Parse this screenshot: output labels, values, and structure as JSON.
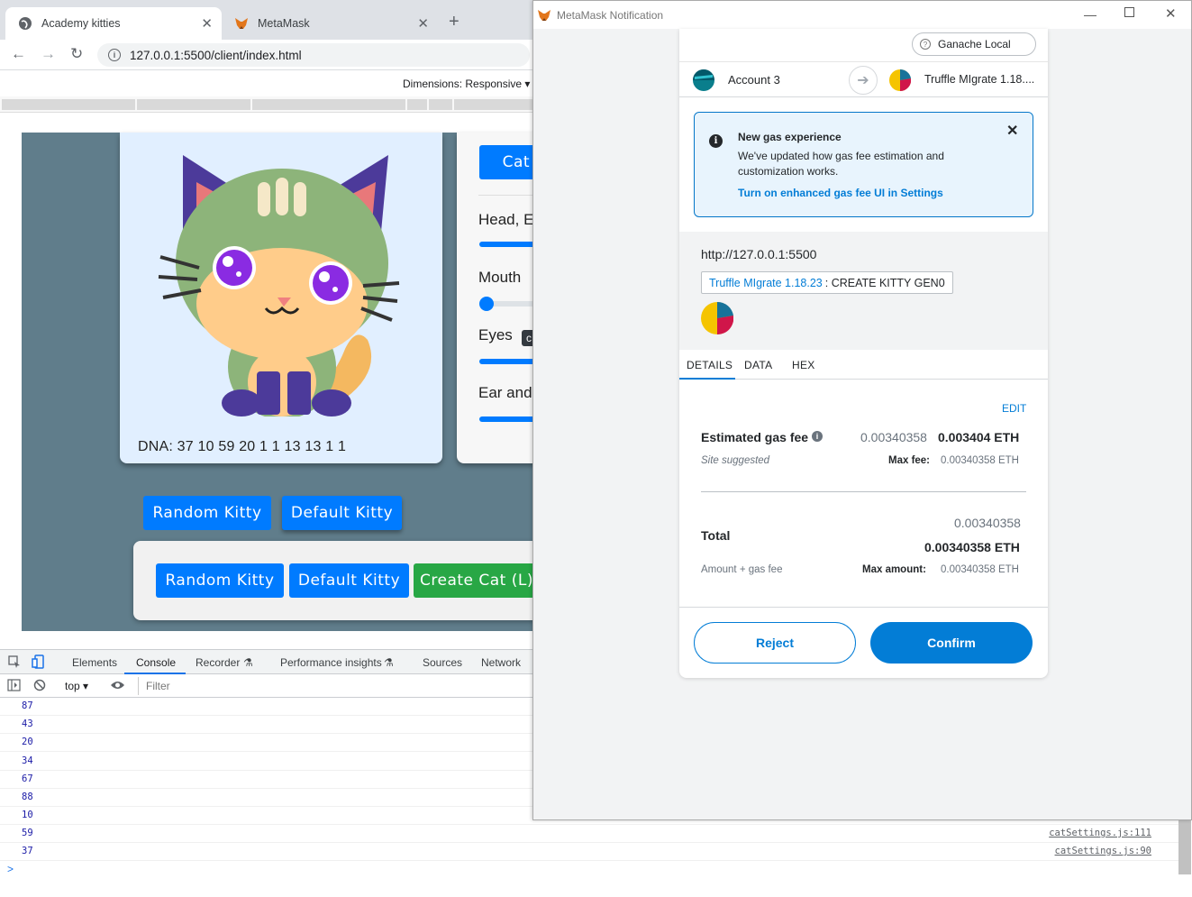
{
  "browser": {
    "tabs": [
      {
        "label": "Academy kitties"
      },
      {
        "label": "MetaMask"
      }
    ],
    "url": "127.0.0.1:5500/client/index.html",
    "dimensions_label": "Dimensions: Responsive"
  },
  "page": {
    "dna_text": "DNA: 37 10 59 20 1 1 13 13 1 1",
    "settings_top_button": "Cat C",
    "labels": {
      "head": "Head, E",
      "mouth": "Mouth",
      "eyes": "Eyes",
      "eyes_badge": "c",
      "ears": "Ear and"
    },
    "row1": {
      "random": "Random Kitty",
      "default": "Default Kitty"
    },
    "row2": {
      "random": "Random Kitty",
      "default": "Default Kitty",
      "create": "Create Cat (L)"
    }
  },
  "devtools": {
    "tabs": [
      "Elements",
      "Console",
      "Recorder",
      "Performance insights",
      "Sources",
      "Network"
    ],
    "context": "top",
    "filter_placeholder": "Filter",
    "log_values": [
      "87",
      "43",
      "20",
      "34",
      "67",
      "88",
      "10",
      "59",
      "37"
    ],
    "log_sources": [
      "",
      "",
      "",
      "",
      "",
      "",
      "",
      "catSettings.js:111",
      "catSettings.js:90"
    ],
    "prompt": ">"
  },
  "metamask": {
    "window_title": "MetaMask Notification",
    "network": "Ganache Local",
    "from_account": "Account 3",
    "to_contract": "Truffle MIgrate 1.18....",
    "notice": {
      "title": "New gas experience",
      "body": "We've updated how gas fee estimation and customization works.",
      "link": "Turn on enhanced gas fee UI in Settings"
    },
    "origin": "http://127.0.0.1:5500",
    "method_contract": "Truffle MIgrate 1.18.23",
    "method_name": ": CREATE KITTY GEN0",
    "tabs": [
      "DETAILS",
      "DATA",
      "HEX"
    ],
    "edit": "EDIT",
    "gas": {
      "label": "Estimated gas fee",
      "secondary": "0.00340358",
      "primary": "0.003404 ETH",
      "site": "Site suggested",
      "max_label": "Max fee:",
      "max_value": "0.00340358 ETH"
    },
    "total": {
      "label": "Total",
      "secondary": "0.00340358",
      "primary": "0.00340358 ETH",
      "sub": "Amount + gas fee",
      "max_label": "Max amount:",
      "max_value": "0.00340358 ETH"
    },
    "reject": "Reject",
    "confirm": "Confirm"
  },
  "colors": {
    "brand_blue": "#007bff",
    "create_green": "#28a745",
    "metamask_blue": "#037dd6",
    "stage": "#607d8b"
  }
}
